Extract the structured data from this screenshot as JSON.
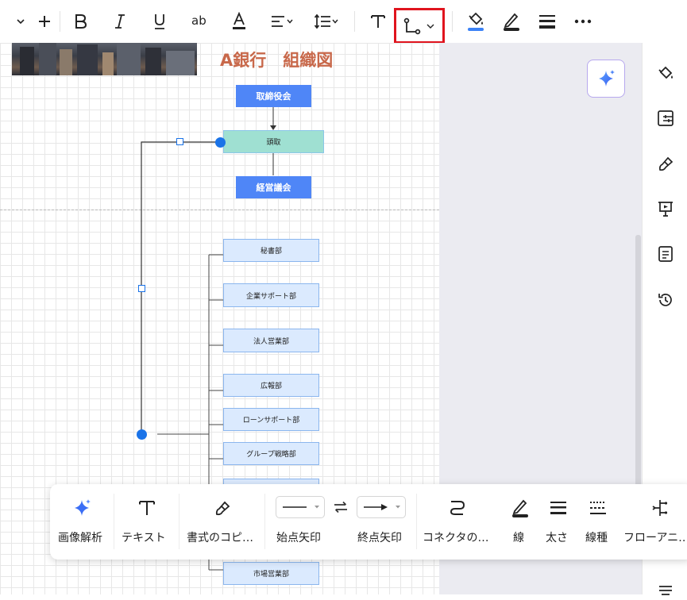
{
  "toolbar": {
    "buttons": [
      "chevron-down",
      "plus",
      "bold",
      "italic",
      "underline",
      "strikethrough",
      "font-color",
      "align",
      "line-spacing",
      "text",
      "connector",
      "fill",
      "line-color",
      "line-weight",
      "more"
    ],
    "highlight_color": "#e0141e",
    "accent_color": "#3b82f6"
  },
  "canvas": {
    "title": "A銀行　組織図",
    "title_color": "#c8684a",
    "nodes": {
      "board": "取締役会",
      "president": "頭取",
      "management": "経営議会"
    },
    "departments": [
      "秘書部",
      "企業サポート部",
      "法人営業部",
      "広報部",
      "ローンサポート部",
      "グループ戦略部",
      "市場営業部"
    ]
  },
  "float_toolbar": {
    "labels": {
      "image_analysis": "画像解析",
      "text": "テキスト",
      "format_painter": "書式のコピ…",
      "start_arrow": "始点矢印",
      "end_arrow": "終点矢印",
      "connector": "コネクタの…",
      "line": "線",
      "thickness": "太さ",
      "line_type": "線種",
      "flow_animation": "フローアニ…"
    }
  },
  "right_sidebar": {
    "icons": [
      "fill-bucket-icon",
      "layout-icon",
      "theme-brush-icon",
      "presentation-icon",
      "document-icon",
      "history-icon"
    ]
  }
}
